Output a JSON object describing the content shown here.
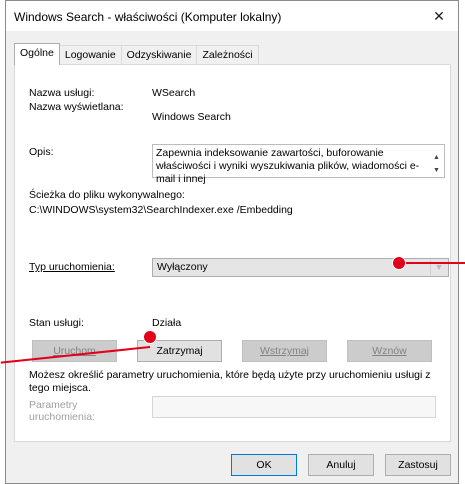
{
  "window": {
    "title": "Windows Search - właściwości (Komputer lokalny)",
    "close_glyph": "✕"
  },
  "tabs": [
    {
      "label": "Ogólne",
      "active": true
    },
    {
      "label": "Logowanie",
      "active": false
    },
    {
      "label": "Odzyskiwanie",
      "active": false
    },
    {
      "label": "Zależności",
      "active": false
    }
  ],
  "general": {
    "service_name_label": "Nazwa usługi:",
    "service_name_value": "WSearch",
    "display_name_label": "Nazwa wyświetlana:",
    "display_name_value": "Windows Search",
    "description_label": "Opis:",
    "description_value": "Zapewnia indeksowanie zawartości, buforowanie właściwości i wyniki wyszukiwania plików, wiadomości e-mail i innej",
    "exe_path_label": "Ścieżka do pliku wykonywalnego:",
    "exe_path_value": "C:\\WINDOWS\\system32\\SearchIndexer.exe /Embedding",
    "startup_type_label": "Typ uruchomienia:",
    "startup_type_value": "Wyłączony",
    "status_label": "Stan usługi:",
    "status_value": "Działa",
    "buttons": {
      "start": "Uruchom",
      "stop": "Zatrzymaj",
      "pause": "Wstrzymaj",
      "resume": "Wznów"
    },
    "params_info": "Możesz określić parametry uruchomienia, które będą użyte przy uruchomieniu usługi z tego miejsca.",
    "params_label": "Parametry uruchomienia:"
  },
  "footer": {
    "ok": "OK",
    "cancel": "Anuluj",
    "apply": "Zastosuj"
  },
  "colors": {
    "callout": "#e2001a"
  }
}
